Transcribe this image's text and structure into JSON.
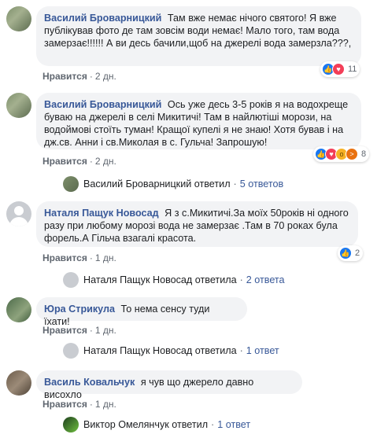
{
  "comments": [
    {
      "author": "Василий Броварницкий",
      "text": "Там вже немає нічого святого! Я вже публікував фото де там зовсім води немає! Мало того, там вода замерзає!!!!!! А ви десь бачили,щоб на джерелі вода замерзла???,",
      "like_label": "Нравится",
      "time": "2 дн.",
      "reactions": [
        "like-icon",
        "love-icon"
      ],
      "reaction_count": "11"
    },
    {
      "author": "Василий Броварницкий",
      "text": "Ось уже десь 3-5 років я на водохреще буваю на джерелі в селі Микитичі! Там в найлютіші морози, на водоймові стоїть туман! Кращої купелі я не знаю! Хотя бував і на дж.св. Анни і св.Миколая в с. Гульча! Запрошую!",
      "like_label": "Нравится",
      "time": "2 дн.",
      "reactions": [
        "like-icon",
        "love-icon",
        "wow-icon",
        "angry-icon"
      ],
      "reaction_count": "8",
      "replies": {
        "author": "Василий Броварницкий",
        "verb": "ответил",
        "count": "5 ответов"
      }
    },
    {
      "author": "Наталя Пащук Новосад",
      "text": "Я з с.Микитичі.За моїх 50років ні одного разу при любому морозі вода не замерзає .Там в 70 роках була форель.А Гільча взагалі красота.",
      "like_label": "Нравится",
      "time": "1 дн.",
      "reactions": [
        "like-icon"
      ],
      "reaction_count": "2",
      "replies": {
        "author": "Наталя Пащук Новосад",
        "verb": "ответила",
        "count": "2 ответа"
      }
    },
    {
      "author": "Юра Стрикула",
      "text": "То нема сенсу туди їхати!",
      "like_label": "Нравится",
      "time": "1 дн.",
      "replies": {
        "author": "Наталя Пащук Новосад",
        "verb": "ответила",
        "count": "1 ответ"
      }
    },
    {
      "author": "Василь Ковальчук",
      "text": "я чув що джерело давно висохло",
      "like_label": "Нравится",
      "time": "1 дн.",
      "replies": {
        "author": "Виктор Омелянчук",
        "verb": "ответил",
        "count": "1 ответ"
      }
    }
  ],
  "colors": {
    "link": "#385898",
    "bubble": "#f2f3f5",
    "meta": "#606770",
    "like": "#1877f2",
    "love": "#f33e58"
  }
}
